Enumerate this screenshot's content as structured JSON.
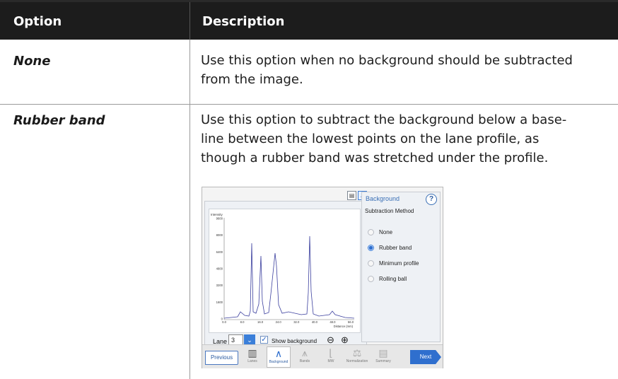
{
  "table": {
    "header_option": "Option",
    "header_description": "Description",
    "rows": [
      {
        "option": "None",
        "lines": [
          "Use this option when no background should be subtracted",
          "from the image."
        ]
      },
      {
        "option": "Rubber band",
        "lines": [
          "Use this option to subtract the background below a base-",
          "line between the lowest points on the lane profile, as",
          "though a rubber band was stretched under the profile."
        ]
      }
    ]
  },
  "screenshot": {
    "panel_title": "Background",
    "help_label": "?",
    "section_label": "Subtraction Method",
    "methods": [
      "None",
      "Rubber band",
      "Minimum profile",
      "Rolling ball"
    ],
    "selected_method": "Rubber band",
    "plot": {
      "ylabel": "Intensity",
      "xlabel": "Distance (mm)",
      "yticks": [
        "9600",
        "8000",
        "6400",
        "4800",
        "3200",
        "1600",
        "0"
      ],
      "xticks": [
        "0.0",
        "8.0",
        "16.0",
        "24.0",
        "32.0",
        "40.0",
        "48.0",
        "56.0"
      ]
    },
    "lane_label": "Lane",
    "lane_value": "3",
    "show_background_label": "Show background",
    "show_background_checked": true,
    "nav": {
      "previous": "Previous",
      "next": "Next",
      "steps": [
        "Lanes",
        "Background",
        "Bands",
        "MW",
        "Normalization",
        "Summary"
      ]
    }
  },
  "colors": {
    "header_bg": "#1c1c1c",
    "accent": "#2f6fce",
    "trace": "#3b3f9e"
  }
}
